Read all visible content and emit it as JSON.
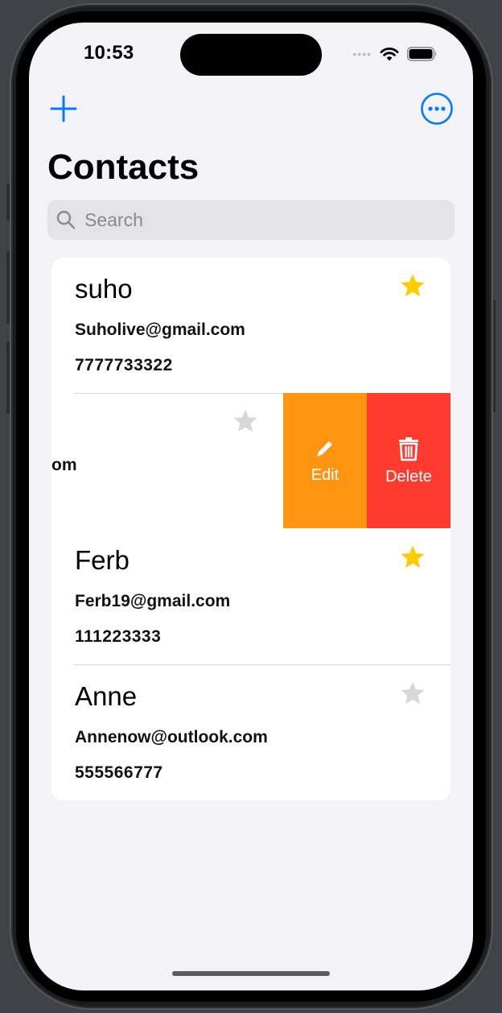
{
  "status_bar": {
    "time": "10:53"
  },
  "nav": {
    "title": "Contacts",
    "add_icon": "plus-icon",
    "more_icon": "ellipsis-circle-icon"
  },
  "search": {
    "placeholder": "Search",
    "icon": "magnifying-glass-icon"
  },
  "contacts": [
    {
      "name": "suho",
      "email": "Suholive@gmail.com",
      "phone": "7777733322",
      "favorite": true
    },
    {
      "name": "",
      "email_fragment": "om",
      "phone": "",
      "favorite": false,
      "swiped": true
    },
    {
      "name": "Ferb",
      "email": "Ferb19@gmail.com",
      "phone": "111223333",
      "favorite": true
    },
    {
      "name": "Anne",
      "email": "Annenow@outlook.com",
      "phone": "555566777",
      "favorite": false
    }
  ],
  "swipe_actions": {
    "edit_label": "Edit",
    "edit_icon": "pencil-icon",
    "delete_label": "Delete",
    "delete_icon": "trash-icon"
  },
  "colors": {
    "accent": "#007aff",
    "favorite_star": "#ffcc00",
    "unfavorite_star": "#d8d8dc",
    "edit_action": "#ff9410",
    "delete_action": "#ff3b30",
    "background": "#f2f2f7"
  }
}
